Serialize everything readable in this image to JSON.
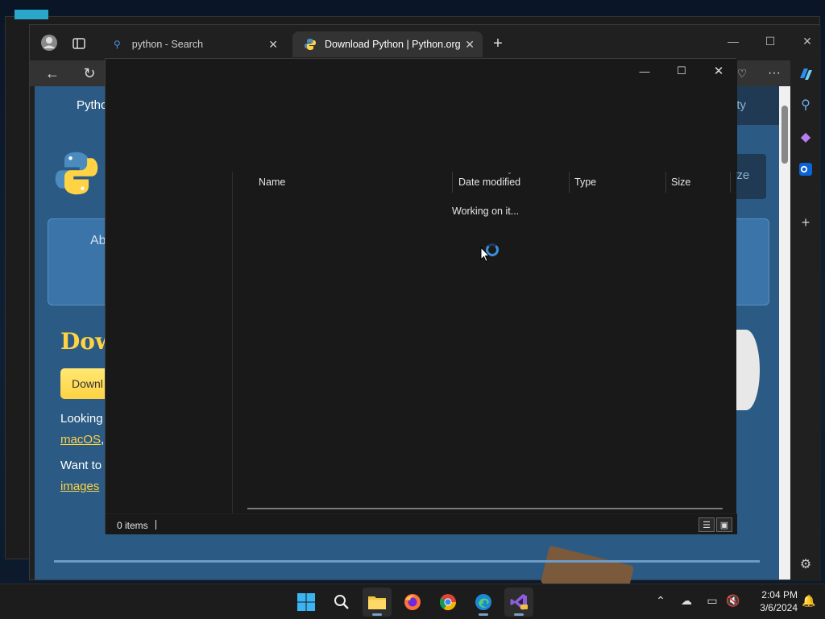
{
  "browser": {
    "tabs": [
      {
        "label": "python - Search",
        "active": false
      },
      {
        "label": "Download Python | Python.org",
        "active": true
      }
    ],
    "new_tab": "+",
    "more_menu": "···"
  },
  "page": {
    "nav_first": "Pytho",
    "nav_right": "ity",
    "search_btn_fragment": "ize",
    "box_fragment": "Ab",
    "heading": "Dow",
    "download_btn": "Downl",
    "line1": "Looking",
    "link1": "macOS",
    "link1_suffix": ",",
    "line2": "Want to",
    "link2": "images"
  },
  "dialog": {
    "columns": [
      "Name",
      "Date modified",
      "Type",
      "Size"
    ],
    "loading_text": "Working on it...",
    "status": "0 items"
  },
  "taskbar": {
    "time": "2:04 PM",
    "date": "3/6/2024"
  },
  "colors": {
    "python_yellow": "#ffd343",
    "python_blue": "#2b5b84",
    "dialog_bg": "#191919",
    "spinner": "#3b8fd9"
  }
}
